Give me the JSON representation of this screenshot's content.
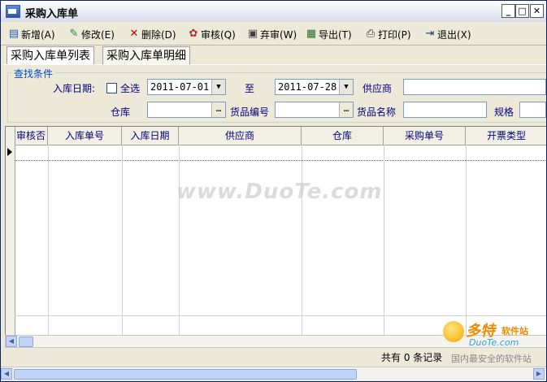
{
  "window": {
    "title": "采购入库单",
    "min": "_",
    "max": "□",
    "close": "✕"
  },
  "toolbar": [
    {
      "label": "新增(A)",
      "icon": "document-new-icon",
      "glyph": "▤",
      "color": "#1F5FB8"
    },
    {
      "label": "修改(E)",
      "icon": "edit-icon",
      "glyph": "✎",
      "color": "#2E8B2E"
    },
    {
      "label": "删除(D)",
      "icon": "delete-icon",
      "glyph": "✕",
      "color": "#C00000"
    },
    {
      "label": "审核(Q)",
      "icon": "audit-icon",
      "glyph": "✿",
      "color": "#B03020"
    },
    {
      "label": "弃审(W)",
      "icon": "unaudit-icon",
      "glyph": "▣",
      "color": "#404040"
    },
    {
      "label": "导出(T)",
      "icon": "export-icon",
      "glyph": "▦",
      "color": "#2A6E2A"
    },
    {
      "label": "打印(P)",
      "icon": "print-icon",
      "glyph": "⎙",
      "color": "#303030"
    },
    {
      "label": "退出(X)",
      "icon": "exit-icon",
      "glyph": "⇥",
      "color": "#1A3A7A"
    }
  ],
  "tabs": [
    "采购入库单列表",
    "采购入库单明细"
  ],
  "search": {
    "group_title": "查找条件",
    "date_label": "入库日期:",
    "all_label": "全选",
    "all_checked": false,
    "date_from": "2011-07-01",
    "to_label": "至",
    "date_to": "2011-07-28",
    "supplier_label": "供应商",
    "supplier_value": "",
    "warehouse_label": "仓库",
    "warehouse_value": "",
    "code_label": "货品编号",
    "code_value": "",
    "name_label": "货品名称",
    "name_value": "",
    "spec_label": "规格",
    "spec_value": "",
    "dots": "…",
    "arrow": "▼"
  },
  "table": {
    "columns": [
      "审核否",
      "入库单号",
      "入库日期",
      "供应商",
      "仓库",
      "采购单号",
      "开票类型"
    ],
    "rows": []
  },
  "status": {
    "count_text": "共有 0 条记录"
  },
  "watermark": "www.DuoTe.com",
  "logo": {
    "brand": "多特",
    "brand_sub": "软件站",
    "url": "DuoTe.com",
    "slogan": "国内最安全的软件站"
  },
  "colors": {
    "title_bg": "#E9ECF5",
    "accent_blue": "#0046D5",
    "label_navy": "#000080",
    "window_bg": "#ECE9D8"
  }
}
